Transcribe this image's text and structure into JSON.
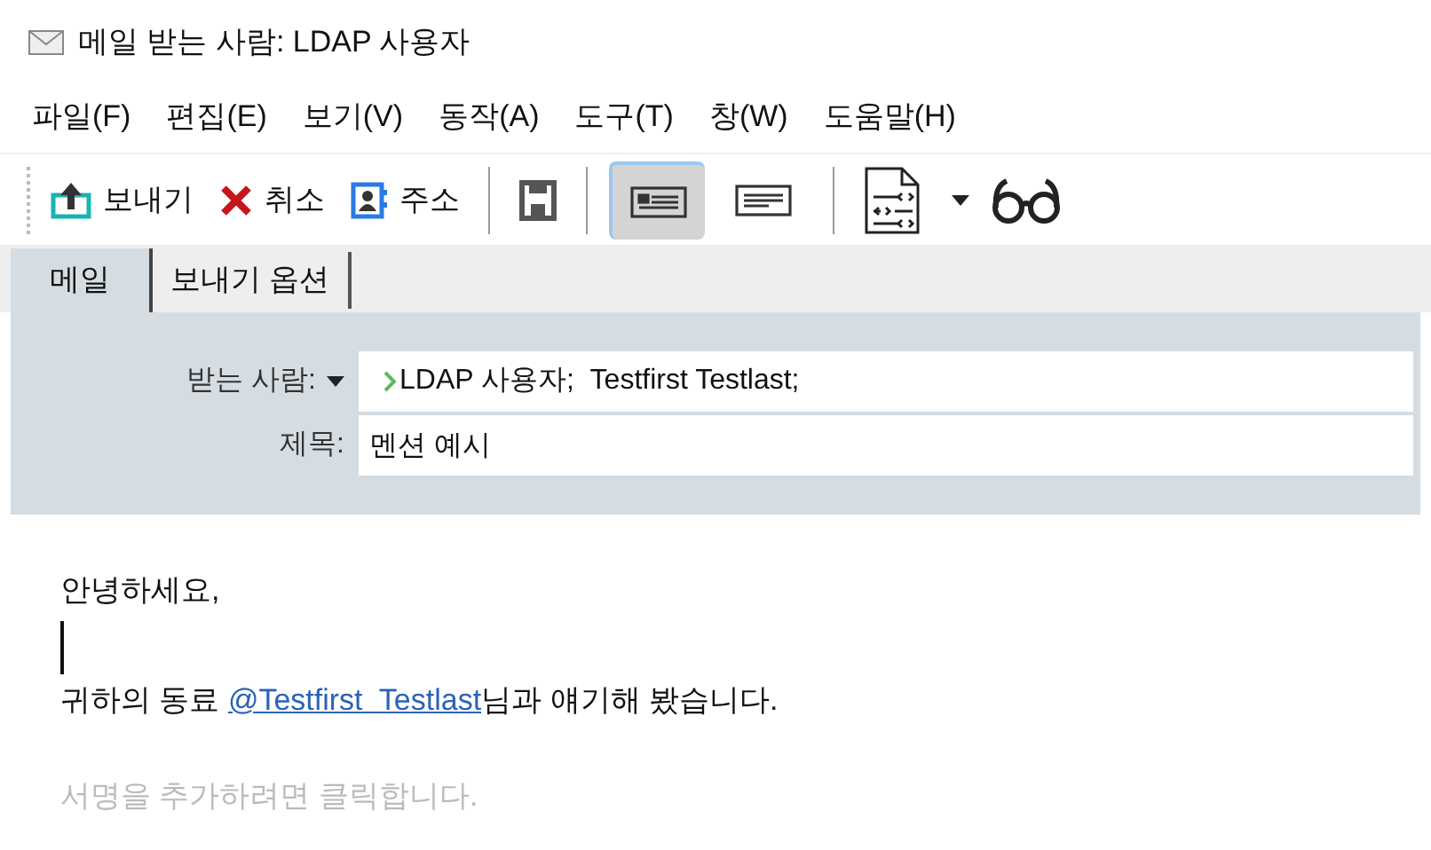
{
  "window": {
    "title": "메일 받는 사람: LDAP 사용자"
  },
  "menu": [
    "파일(F)",
    "편집(E)",
    "보기(V)",
    "동작(A)",
    "도구(T)",
    "창(W)",
    "도움말(H)"
  ],
  "toolbar": {
    "buttons": [
      {
        "kind": "send",
        "label": "보내기"
      },
      {
        "kind": "cancel",
        "label": "취소"
      },
      {
        "kind": "address",
        "label": "주소"
      }
    ],
    "views": [
      {
        "kind": "card",
        "selected": true
      },
      {
        "kind": "lines",
        "selected": false
      }
    ]
  },
  "tabs": [
    {
      "label": "메일",
      "selected": true
    },
    {
      "label": "보내기 옵션",
      "selected": false
    }
  ],
  "header": {
    "to_label": "받는 사람:",
    "to_value": "LDAP 사용자;  Testfirst Testlast;",
    "subject_label": "제목:",
    "subject_value": "멘션 예시"
  },
  "body": {
    "greeting": "안녕하세요,",
    "before": "귀하의 동료 ",
    "mention": "@Testfirst  Testlast",
    "after": "님과 얘기해 봤습니다.",
    "signature_placeholder": "서명을 추가하려면 클릭합니다."
  }
}
